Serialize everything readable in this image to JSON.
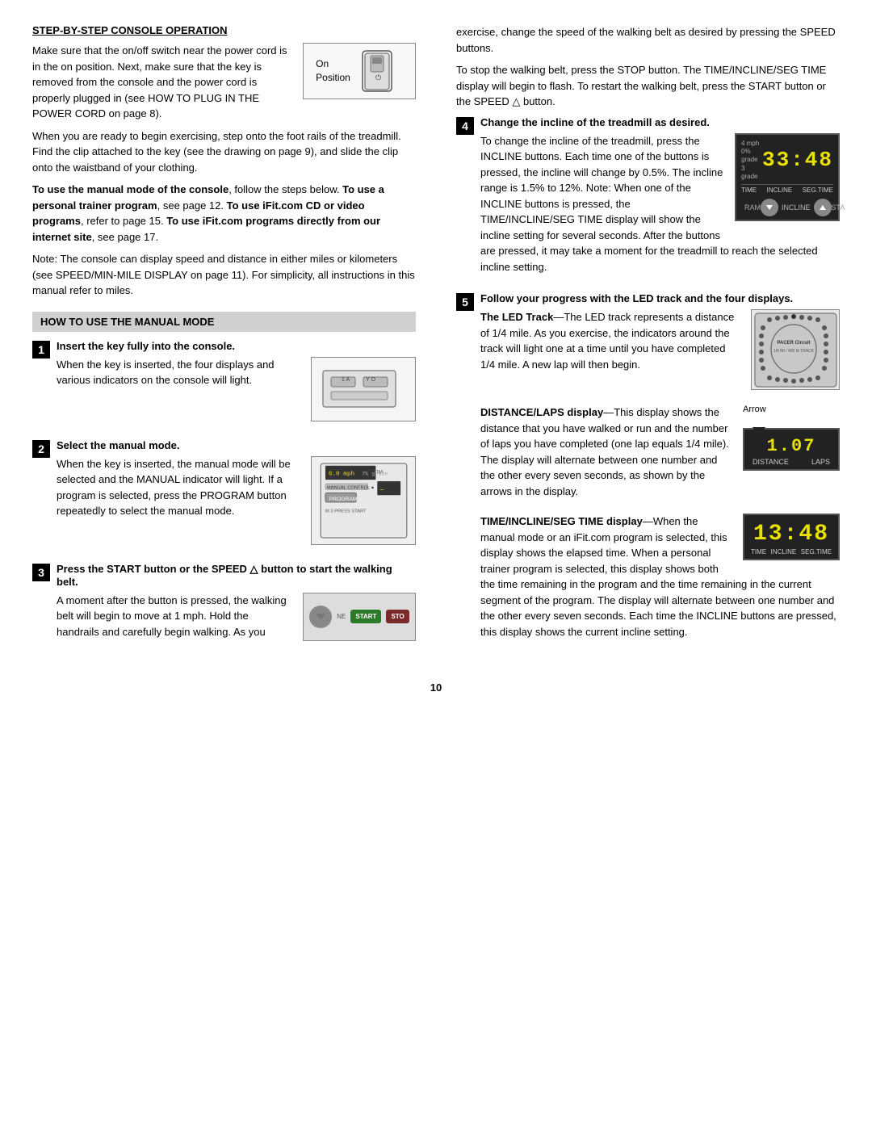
{
  "page": {
    "number": "10",
    "left_column": {
      "section_header": "STEP-BY-STEP CONSOLE OPERATION",
      "intro_paragraphs": [
        "Make sure that the on/off switch near the power cord is in the on position. Next, make sure that the key is removed from the console and the power cord is properly plugged in (see HOW TO PLUG IN THE POWER CORD on page 8).",
        "When you are ready to begin exercising, step onto the foot rails of the treadmill. Find the clip attached to the key (see the drawing on page 9), and slide the clip onto the waistband of your clothing."
      ],
      "bold_paragraph": "To use the manual mode of the console, follow the steps below. To use a personal trainer program, see page 12. To use iFit.com CD or video programs, refer to page 15. To use iFit.com programs directly from our internet site, see page 17.",
      "note_paragraph": "Note: The console can display speed and distance in either miles or kilometers (see SPEED/MIN-MILE DISPLAY on page 11). For simplicity, all instructions in this manual refer to miles.",
      "manual_mode_header": "HOW TO USE THE MANUAL MODE",
      "steps": [
        {
          "number": "1",
          "title": "Insert the key fully into the console.",
          "body": "When the key is inserted, the four displays and various indicators on the console will light."
        },
        {
          "number": "2",
          "title": "Select the manual mode.",
          "body": "When the key is inserted, the manual mode will be selected and the MANUAL indicator will light. If a program is selected, press the PROGRAM button repeatedly to select the manual mode."
        },
        {
          "number": "3",
          "title": "Press the START button or the SPEED △ button to start the walking belt.",
          "body": "A moment after the button is pressed, the walking belt will begin to move at 1 mph. Hold the handrails and carefully begin walking. As you"
        }
      ],
      "on_position_label": "On\nPosition"
    },
    "right_column": {
      "right_intro_paragraphs": [
        "exercise, change the speed of the walking belt as desired by pressing the SPEED buttons.",
        "To stop the walking belt, press the STOP button. The TIME/INCLINE/SEG TIME display will begin to flash. To restart the walking belt, press the START button or the SPEED △ button."
      ],
      "steps": [
        {
          "number": "4",
          "title": "Change the incline of the treadmill as desired.",
          "body": "To change the incline of the treadmill, press the INCLINE buttons. Each time one of the buttons is pressed, the incline will change by 0.5%. The incline range is 1.5% to 12%. Note: When one of the INCLINE buttons is pressed, the TIME/INCLINE/SEG TIME display will show the incline setting for several seconds. After the buttons are pressed, it may take a moment for the treadmill to reach the selected incline setting."
        },
        {
          "number": "5",
          "title": "Follow your progress with the LED track and the four displays.",
          "subsections": [
            {
              "subtitle": "The LED Track",
              "body": "—The LED track represents a distance of 1/4 mile. As you exercise, the indicators around the track will light one at a time until you have completed 1/4 mile. A new lap will then begin."
            },
            {
              "subtitle": "DISTANCE/LAPS dis-play",
              "body": "—This display shows the distance that you have walked or run and the number of laps you have completed (one lap equals 1/4 mile). The display will alternate between one number and the other every seven seconds, as shown by the arrows in the display."
            },
            {
              "subtitle": "TIME/INCLINE/SEG TIME display",
              "body": "—When the manual mode or an iFit.com program is selected, this display shows the elapsed time. When a personal trainer program is selected, this display shows both the time remaining in the program and the time remaining in the current segment of the program. The display will alternate between one number and the other every seven seconds. Each time the INCLINE buttons are pressed, this display shows the current incline setting."
            }
          ]
        }
      ],
      "displays": {
        "incline": "33:48",
        "incline_labels": [
          "TIME",
          "INCLINE",
          "SEG.TIME"
        ],
        "distance": "1.07",
        "distance_labels": [
          "DISTANCE",
          "LAPS"
        ],
        "time": "13:48",
        "time_labels": [
          "TIME",
          "INCLINE",
          "SEG.TIME"
        ],
        "arrow_label": "Arrow"
      }
    }
  }
}
